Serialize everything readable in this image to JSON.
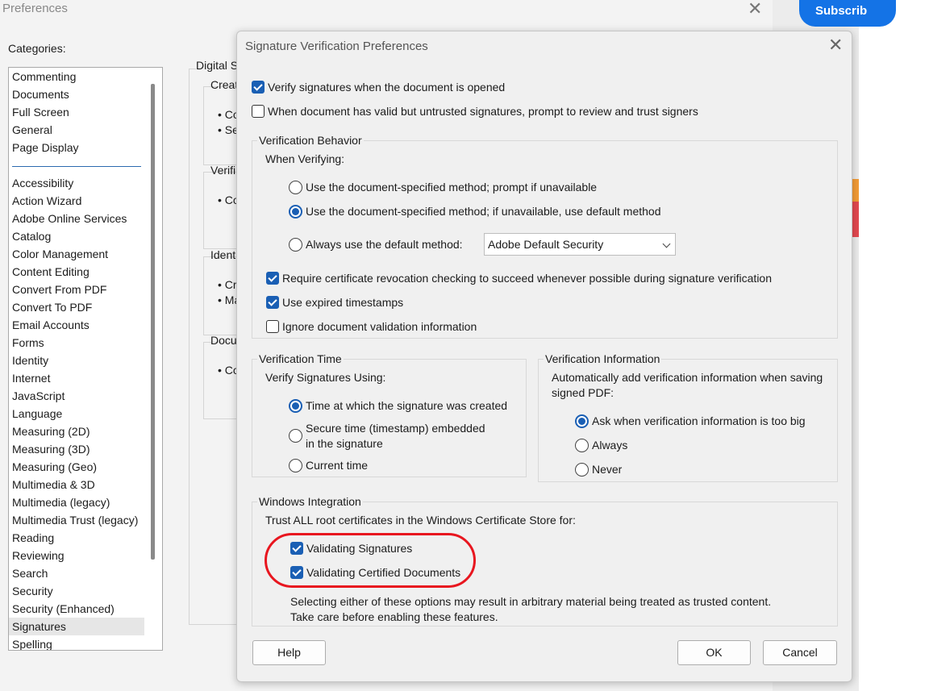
{
  "prefs": {
    "title": "Preferences",
    "close_glyph": "✕",
    "categories_label": "Categories:",
    "categories": [
      "Commenting",
      "Documents",
      "Full Screen",
      "General",
      "Page Display",
      "Accessibility",
      "Action Wizard",
      "Adobe Online Services",
      "Catalog",
      "Color Management",
      "Content Editing",
      "Convert From PDF",
      "Convert To PDF",
      "Email Accounts",
      "Forms",
      "Identity",
      "Internet",
      "JavaScript",
      "Language",
      "Measuring (2D)",
      "Measuring (3D)",
      "Measuring (Geo)",
      "Multimedia & 3D",
      "Multimedia (legacy)",
      "Multimedia Trust (legacy)",
      "Reading",
      "Reviewing",
      "Search",
      "Security",
      "Security (Enhanced)",
      "Signatures",
      "Spelling"
    ],
    "selected_category": "Signatures",
    "background_panel": {
      "group_title": "Digital Si",
      "sections": [
        {
          "title": "Creat",
          "lines": [
            "• Co",
            "• Se"
          ]
        },
        {
          "title": "Verifi",
          "lines": [
            "• Co"
          ]
        },
        {
          "title": "Ident",
          "lines": [
            "• Cr",
            "• Ma"
          ]
        },
        {
          "title": "Docu",
          "lines": [
            "• Co"
          ]
        }
      ]
    }
  },
  "subscribe_label": "Subscrib",
  "dialog": {
    "title": "Signature Verification Preferences",
    "close_glyph": "✕",
    "verify_on_open": {
      "label": "Verify signatures when the document is opened",
      "checked": true
    },
    "prompt_untrusted": {
      "label": "When document has valid but untrusted signatures, prompt to review and trust signers",
      "checked": false
    },
    "behavior": {
      "title": "Verification Behavior",
      "when_verifying": "When Verifying:",
      "options": [
        {
          "label": "Use the document-specified method; prompt if unavailable",
          "selected": false
        },
        {
          "label": "Use the document-specified method; if unavailable, use default method",
          "selected": true
        },
        {
          "label": "Always use the default method:",
          "selected": false
        }
      ],
      "default_method": "Adobe Default Security",
      "checks": [
        {
          "label": "Require certificate revocation checking to succeed whenever possible during signature verification",
          "checked": true
        },
        {
          "label": "Use expired timestamps",
          "checked": true
        },
        {
          "label": "Ignore document validation information",
          "checked": false
        }
      ]
    },
    "time": {
      "title": "Verification Time",
      "subtitle": "Verify Signatures Using:",
      "options": [
        {
          "label": "Time at which the signature was created",
          "selected": true
        },
        {
          "label": "Secure time (timestamp) embedded",
          "label2": "in the signature",
          "selected": false
        },
        {
          "label": "Current time",
          "selected": false
        }
      ]
    },
    "info": {
      "title": "Verification Information",
      "desc1": "Automatically add verification information when saving",
      "desc2": "signed PDF:",
      "options": [
        {
          "label": "Ask when verification information is too big",
          "selected": true
        },
        {
          "label": "Always",
          "selected": false
        },
        {
          "label": "Never",
          "selected": false
        }
      ]
    },
    "windows": {
      "title": "Windows Integration",
      "desc": "Trust ALL root certificates in the Windows Certificate Store for:",
      "checks": [
        {
          "label": "Validating Signatures",
          "checked": true
        },
        {
          "label": "Validating Certified Documents",
          "checked": true
        }
      ],
      "warning1": "Selecting either of these options may result in arbitrary material being treated as trusted content.",
      "warning2": "Take care before enabling these features."
    },
    "help_label": "Help",
    "ok_label": "OK",
    "cancel_label": "Cancel"
  },
  "colors": {
    "accent": "#1a5fb4",
    "highlight_oval": "#e8161f",
    "subscribe": "#1473e6"
  }
}
